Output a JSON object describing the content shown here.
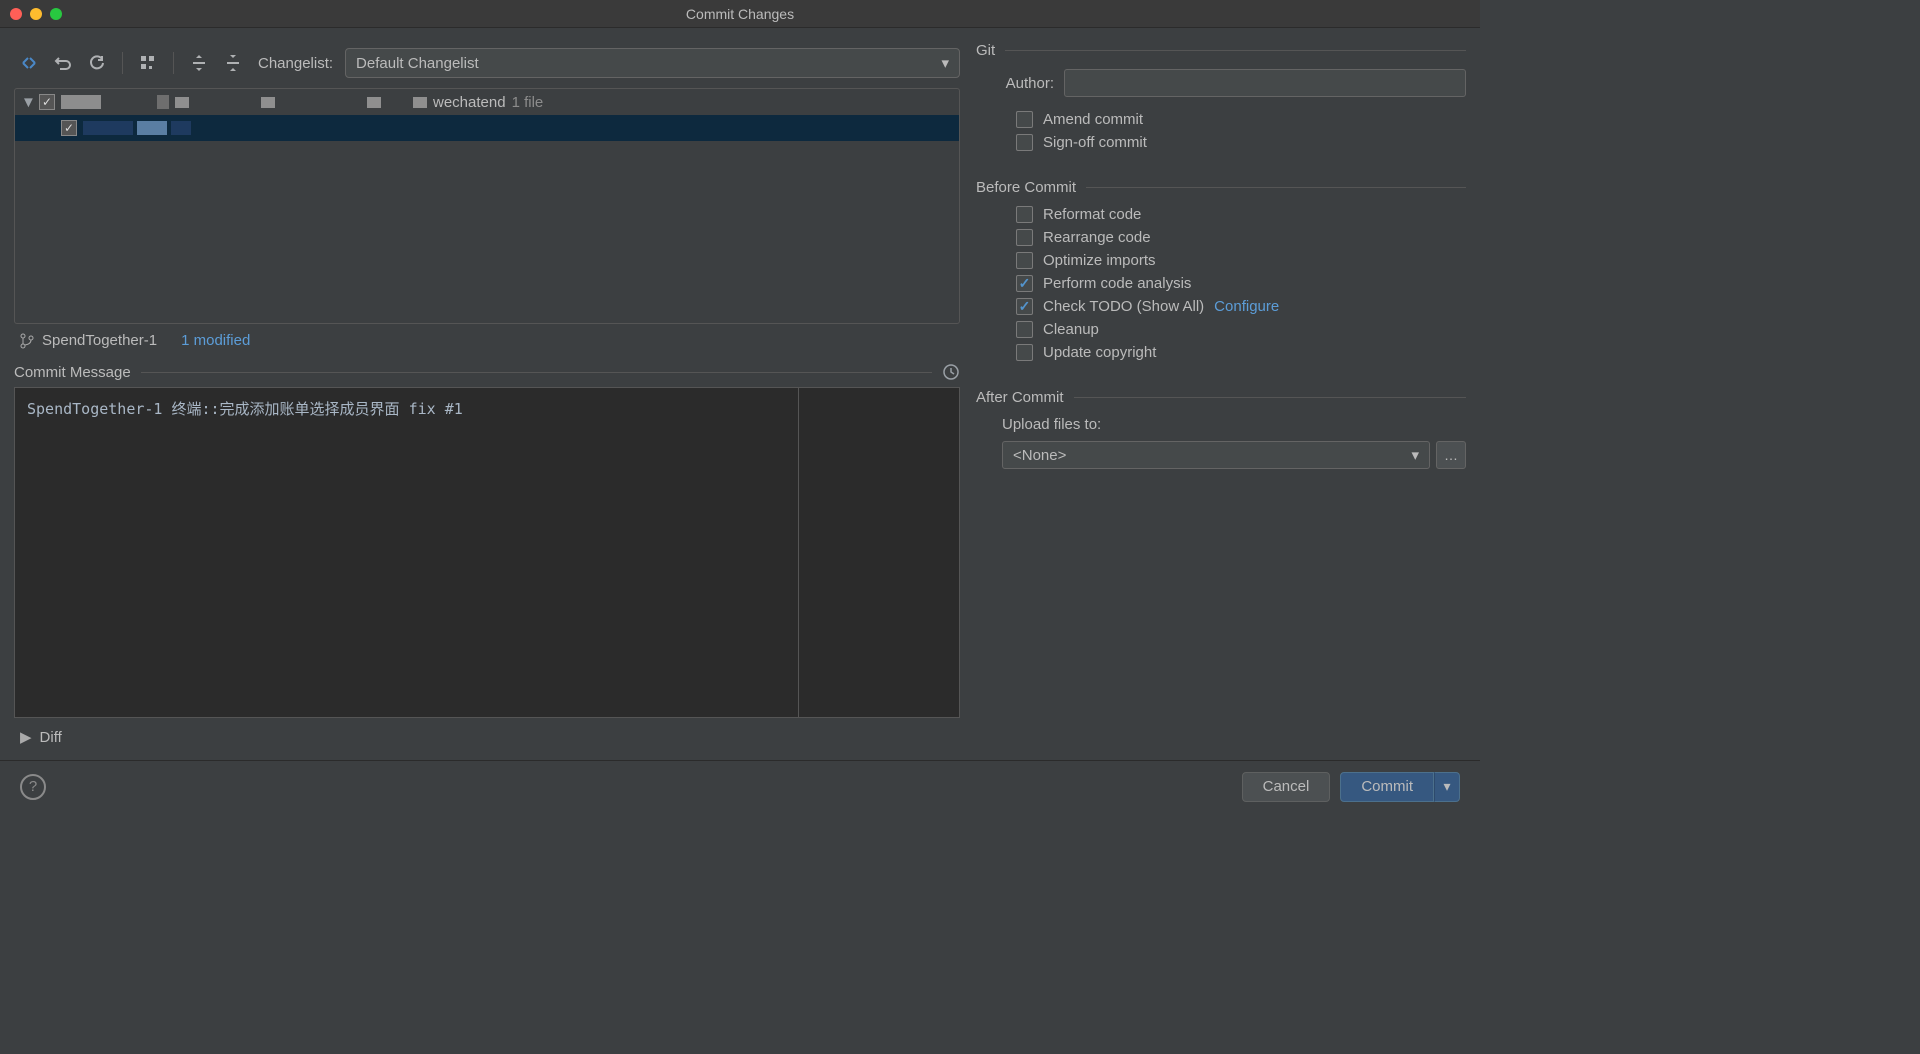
{
  "window": {
    "title": "Commit Changes"
  },
  "toolbar": {
    "changelist_label": "Changelist:",
    "changelist_value": "Default Changelist"
  },
  "filetree": {
    "project_suffix": "wechatend",
    "file_count_hint": "1 file"
  },
  "branch": {
    "name": "SpendTogether-1",
    "modified": "1 modified"
  },
  "commit_message": {
    "section_title": "Commit Message",
    "text": "SpendTogether-1 终端::完成添加账单选择成员界面 fix #1"
  },
  "diff": {
    "label": "Diff"
  },
  "git": {
    "section": "Git",
    "author_label": "Author:",
    "author_value": "",
    "amend_label": "Amend commit",
    "signoff_label": "Sign-off commit"
  },
  "before_commit": {
    "section": "Before Commit",
    "reformat": "Reformat code",
    "rearrange": "Rearrange code",
    "optimize": "Optimize imports",
    "analysis": "Perform code analysis",
    "todo": "Check TODO (Show All)",
    "configure": "Configure",
    "cleanup": "Cleanup",
    "copyright": "Update copyright"
  },
  "after_commit": {
    "section": "After Commit",
    "upload_label": "Upload files to:",
    "upload_value": "<None>"
  },
  "footer": {
    "cancel": "Cancel",
    "commit": "Commit"
  }
}
